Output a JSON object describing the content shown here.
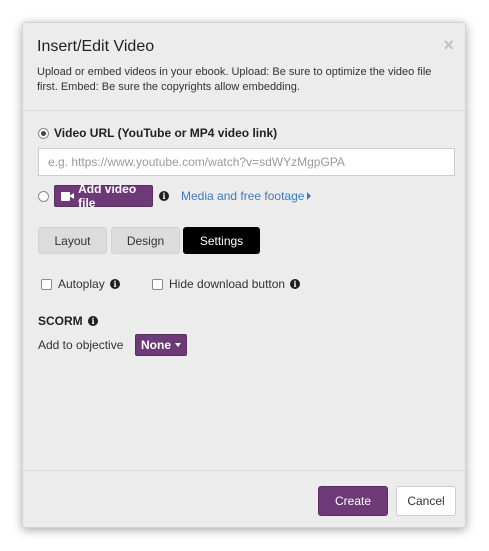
{
  "dialog": {
    "title": "Insert/Edit Video",
    "close_glyph": "×",
    "description": "Upload or embed videos in your ebook. Upload: Be sure to optimize the video file first. Embed: Be sure the copyrights allow embedding."
  },
  "source": {
    "url_option_label": "Video URL (YouTube or MP4 video link)",
    "url_option_checked": true,
    "url_value": "",
    "url_placeholder": "e.g. https://www.youtube.com/watch?v=sdWYzMgpGPA",
    "file_option_checked": false,
    "add_file_label": "Add video file",
    "add_file_icon": "video-camera-icon",
    "media_link_label": "Media and free footage",
    "media_link_icon": "caret-right-icon"
  },
  "tabs": [
    {
      "label": "Layout",
      "active": false
    },
    {
      "label": "Design",
      "active": false
    },
    {
      "label": "Settings",
      "active": true
    }
  ],
  "settings": {
    "autoplay_label": "Autoplay",
    "autoplay_checked": false,
    "hide_download_label": "Hide download button",
    "hide_download_checked": false,
    "scorm_heading": "SCORM",
    "objective_label": "Add to objective",
    "objective_value": "None"
  },
  "info_glyph": "i",
  "footer": {
    "create_label": "Create",
    "cancel_label": "Cancel"
  },
  "colors": {
    "accent": "#6d3a77",
    "link": "#3b7bbf",
    "active_tab": "#000000",
    "dialog_bg": "#ececec"
  }
}
